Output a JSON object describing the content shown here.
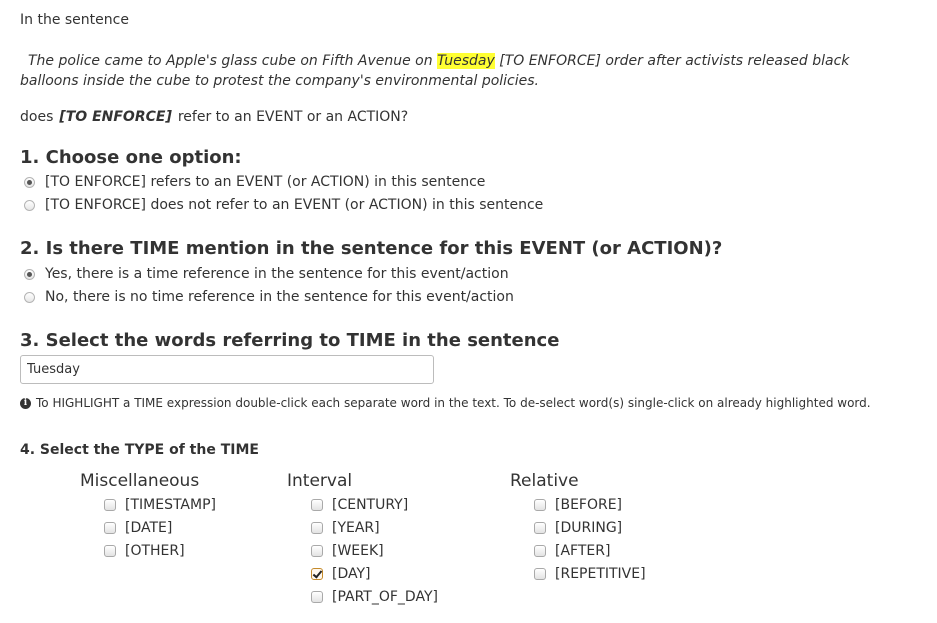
{
  "intro": "In the sentence",
  "sentence": {
    "before": "The police came to Apple's glass cube on Fifth Avenue on",
    "highlight": "Tuesday",
    "after": "[TO ENFORCE] order after activists released black balloons inside the cube to protest the company's environmental policies."
  },
  "question": {
    "prefix": "does",
    "target": "[TO ENFORCE]",
    "suffix": "refer to an EVENT or an ACTION?"
  },
  "section1": {
    "title": "1. Choose one option:",
    "options": [
      {
        "label": "[TO ENFORCE] refers to an EVENT (or ACTION) in this sentence",
        "selected": true
      },
      {
        "label": "[TO ENFORCE] does not refer to an EVENT (or ACTION) in this sentence",
        "selected": false
      }
    ]
  },
  "section2": {
    "title": "2. Is there TIME mention in the sentence for this EVENT (or ACTION)?",
    "options": [
      {
        "label": "Yes, there is a time reference in the sentence for this event/action",
        "selected": true
      },
      {
        "label": "No, there is no time reference in the sentence for this event/action",
        "selected": false
      }
    ]
  },
  "section3": {
    "title": "3. Select the words referring to TIME in the sentence",
    "input_value": "Tuesday",
    "help": "To HIGHLIGHT a TIME expression double-click each separate word in the text. To de-select word(s) single-click on already highlighted word."
  },
  "section4": {
    "title": "4. Select the TYPE of the TIME",
    "columns": [
      {
        "heading": "Miscellaneous",
        "items": [
          {
            "label": "[TIMESTAMP]",
            "checked": false
          },
          {
            "label": "[DATE]",
            "checked": false
          },
          {
            "label": "[OTHER]",
            "checked": false
          }
        ]
      },
      {
        "heading": "Interval",
        "items": [
          {
            "label": "[CENTURY]",
            "checked": false
          },
          {
            "label": "[YEAR]",
            "checked": false
          },
          {
            "label": "[WEEK]",
            "checked": false
          },
          {
            "label": "[DAY]",
            "checked": true
          },
          {
            "label": "[PART_OF_DAY]",
            "checked": false
          }
        ]
      },
      {
        "heading": "Relative",
        "items": [
          {
            "label": "[BEFORE]",
            "checked": false
          },
          {
            "label": "[DURING]",
            "checked": false
          },
          {
            "label": "[AFTER]",
            "checked": false
          },
          {
            "label": "[REPETITIVE]",
            "checked": false
          }
        ]
      }
    ]
  }
}
